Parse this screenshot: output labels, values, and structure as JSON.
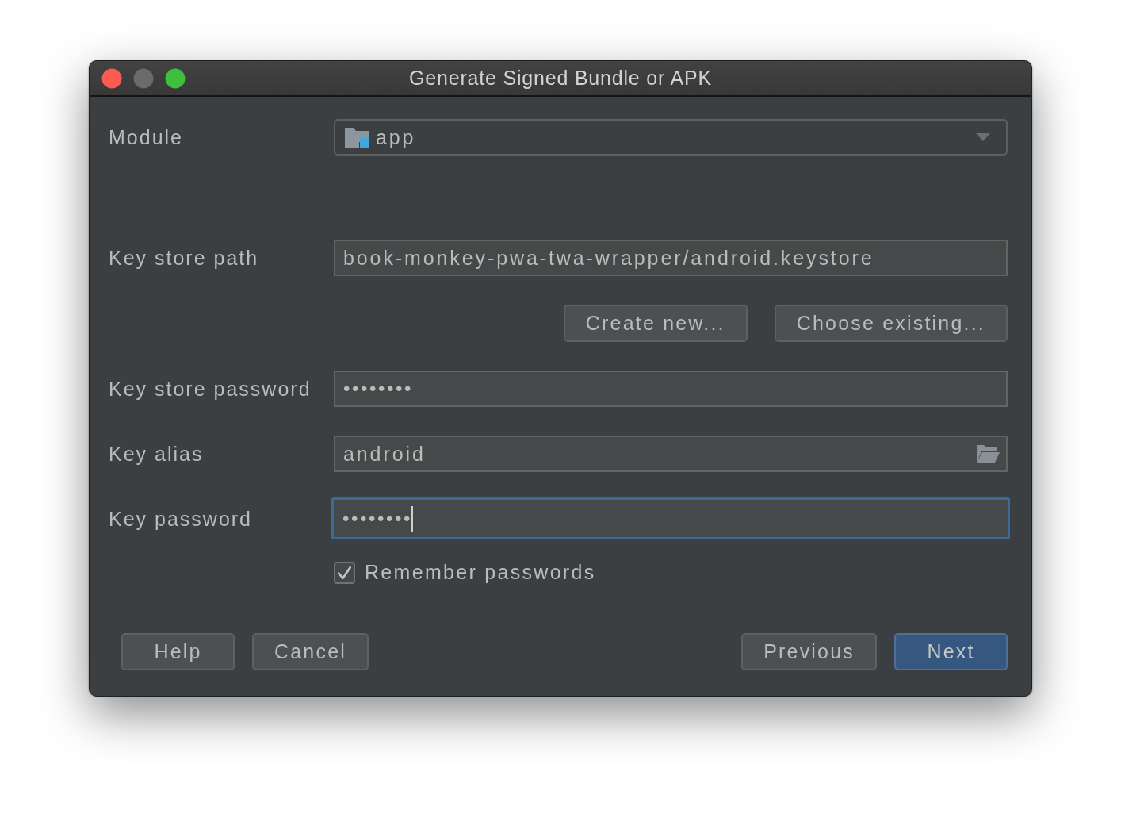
{
  "window": {
    "title": "Generate Signed Bundle or APK",
    "controls": [
      {
        "kind": "close",
        "disabled": false
      },
      {
        "kind": "minimize",
        "disabled": true
      },
      {
        "kind": "zoom",
        "disabled": false
      }
    ]
  },
  "fields": [
    {
      "kind": "dropdown",
      "label": "Module",
      "value": "app",
      "focused": false
    },
    {
      "kind": "text",
      "label": "Key store path",
      "value": "book-monkey-pwa-twa-wrapper/android.keystore",
      "focused": false
    },
    {
      "kind": "buttons",
      "buttons": [
        "Create new...",
        "Choose existing..."
      ]
    },
    {
      "kind": "password",
      "label": "Key store password",
      "value": "••••••••",
      "focused": false
    },
    {
      "kind": "combo",
      "label": "Key alias",
      "value": "android",
      "focused": false
    },
    {
      "kind": "password",
      "label": "Key password",
      "value": "••••••••",
      "focused": true
    }
  ],
  "remember": {
    "label": "Remember passwords",
    "checked": true
  },
  "left_buttons": [
    {
      "label": "Help",
      "primary": false
    },
    {
      "label": "Cancel",
      "primary": false
    }
  ],
  "right_buttons": [
    {
      "label": "Previous",
      "primary": false
    },
    {
      "label": "Next",
      "primary": true
    }
  ]
}
